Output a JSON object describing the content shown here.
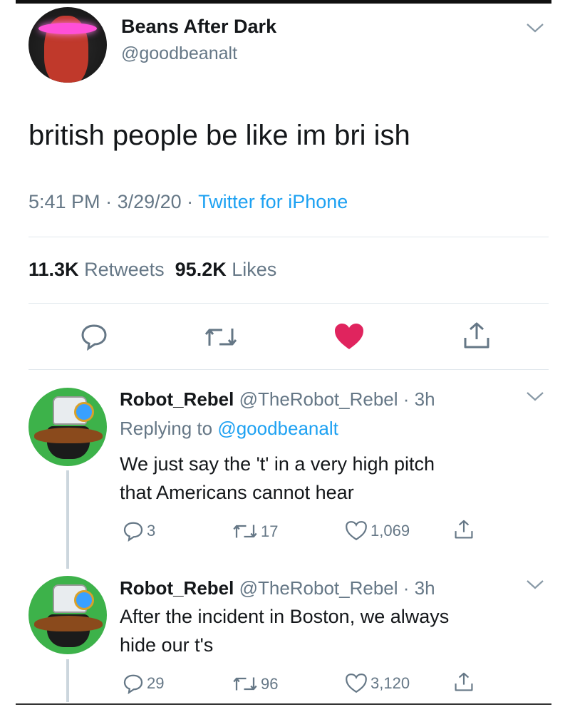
{
  "tweet": {
    "author_name": "Beans After Dark",
    "author_handle": "@goodbeanalt",
    "text": "british people be like im bri ish",
    "time": "5:41 PM",
    "date": "3/29/20",
    "separator": " · ",
    "source": "Twitter for iPhone",
    "retweets_count": "11.3K",
    "retweets_label": "Retweets",
    "likes_count": "95.2K",
    "likes_label": "Likes"
  },
  "colors": {
    "like_red": "#e0245e",
    "link_blue": "#1da1f2",
    "muted": "#657786",
    "avatar_green": "#3db24a"
  },
  "icons": [
    "chevron-down-icon",
    "reply-icon",
    "retweet-icon",
    "heart-icon",
    "share-icon"
  ],
  "replies": [
    {
      "name": "Robot_Rebel",
      "handle": "@TheRobot_Rebel",
      "age": "3h",
      "replying_prefix": "Replying to",
      "replying_to": "@goodbeanalt",
      "lines": [
        "We just say the 't' in a very high pitch",
        "that Americans cannot hear"
      ],
      "reply_count": "3",
      "retweet_count": "17",
      "like_count": "1,069"
    },
    {
      "name": "Robot_Rebel",
      "handle": "@TheRobot_Rebel",
      "age": "3h",
      "lines": [
        "After the incident in Boston, we always",
        "hide our t's"
      ],
      "reply_count": "29",
      "retweet_count": "96",
      "like_count": "3,120"
    }
  ]
}
